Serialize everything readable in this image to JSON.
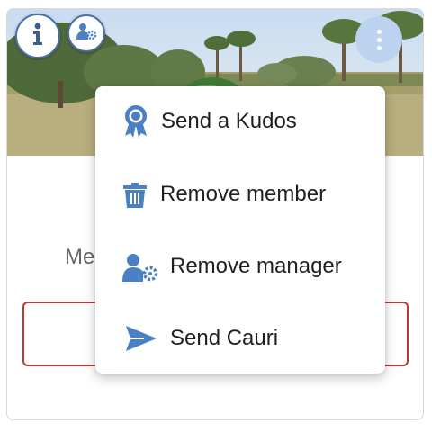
{
  "buttons": {
    "info_icon": "info-icon",
    "manager_icon": "user-cog-icon",
    "more_icon": "more-vertical-icon"
  },
  "card": {
    "member_label": "Me"
  },
  "menu": {
    "items": [
      {
        "label": "Send a Kudos",
        "icon": "award-icon"
      },
      {
        "label": "Remove member",
        "icon": "trash-icon"
      },
      {
        "label": "Remove manager",
        "icon": "user-cog-icon"
      },
      {
        "label": "Send Cauri",
        "icon": "send-icon"
      }
    ]
  },
  "colors": {
    "accent": "#4a80c4",
    "danger": "#b83b3b",
    "more_button": "#bcd3ef"
  }
}
